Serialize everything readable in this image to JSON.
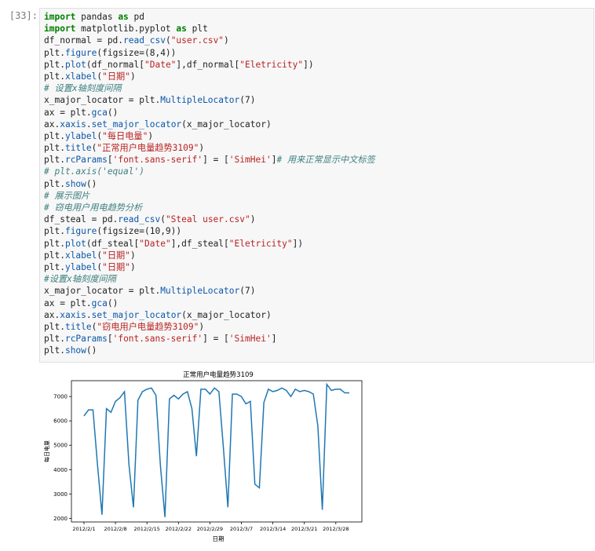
{
  "cell": {
    "prompt": "[33]:"
  },
  "code_lines": [
    [
      {
        "t": "kw",
        "v": "import"
      },
      {
        "t": "n",
        "v": " pandas "
      },
      {
        "t": "kw",
        "v": "as"
      },
      {
        "t": "n",
        "v": " pd"
      }
    ],
    [
      {
        "t": "kw",
        "v": "import"
      },
      {
        "t": "n",
        "v": " matplotlib.pyplot "
      },
      {
        "t": "kw",
        "v": "as"
      },
      {
        "t": "n",
        "v": " plt"
      }
    ],
    [
      {
        "t": "n",
        "v": "df_normal = pd."
      },
      {
        "t": "fn",
        "v": "read_csv"
      },
      {
        "t": "n",
        "v": "("
      },
      {
        "t": "st",
        "v": "\"user.csv\""
      },
      {
        "t": "n",
        "v": ")"
      }
    ],
    [
      {
        "t": "n",
        "v": "plt."
      },
      {
        "t": "fn",
        "v": "figure"
      },
      {
        "t": "n",
        "v": "(figsize=(8,4))"
      }
    ],
    [
      {
        "t": "n",
        "v": "plt."
      },
      {
        "t": "fn",
        "v": "plot"
      },
      {
        "t": "n",
        "v": "(df_normal["
      },
      {
        "t": "st",
        "v": "\"Date\""
      },
      {
        "t": "n",
        "v": "],df_normal["
      },
      {
        "t": "st",
        "v": "\"Eletricity\""
      },
      {
        "t": "n",
        "v": "])"
      }
    ],
    [
      {
        "t": "n",
        "v": "plt."
      },
      {
        "t": "fn",
        "v": "xlabel"
      },
      {
        "t": "n",
        "v": "("
      },
      {
        "t": "st",
        "v": "\"日期\""
      },
      {
        "t": "n",
        "v": ")"
      }
    ],
    [
      {
        "t": "cm",
        "v": "# 设置x轴刻度间隔"
      }
    ],
    [
      {
        "t": "n",
        "v": "x_major_locator = plt."
      },
      {
        "t": "fn",
        "v": "MultipleLocator"
      },
      {
        "t": "n",
        "v": "(7)"
      }
    ],
    [
      {
        "t": "n",
        "v": "ax = plt."
      },
      {
        "t": "fn",
        "v": "gca"
      },
      {
        "t": "n",
        "v": "()"
      }
    ],
    [
      {
        "t": "n",
        "v": "ax."
      },
      {
        "t": "fn",
        "v": "xaxis"
      },
      {
        "t": "n",
        "v": "."
      },
      {
        "t": "fn",
        "v": "set_major_locator"
      },
      {
        "t": "n",
        "v": "(x_major_locator)"
      }
    ],
    [
      {
        "t": "n",
        "v": "plt."
      },
      {
        "t": "fn",
        "v": "ylabel"
      },
      {
        "t": "n",
        "v": "("
      },
      {
        "t": "st",
        "v": "\"每日电量\""
      },
      {
        "t": "n",
        "v": ")"
      }
    ],
    [
      {
        "t": "n",
        "v": "plt."
      },
      {
        "t": "fn",
        "v": "title"
      },
      {
        "t": "n",
        "v": "("
      },
      {
        "t": "st",
        "v": "\"正常用户电量趋势3109\""
      },
      {
        "t": "n",
        "v": ")"
      }
    ],
    [
      {
        "t": "n",
        "v": "plt."
      },
      {
        "t": "fn",
        "v": "rcParams"
      },
      {
        "t": "n",
        "v": "["
      },
      {
        "t": "st",
        "v": "'font.sans-serif'"
      },
      {
        "t": "n",
        "v": "] = ["
      },
      {
        "t": "st",
        "v": "'SimHei'"
      },
      {
        "t": "n",
        "v": "]"
      },
      {
        "t": "cm",
        "v": "# 用来正常显示中文标签"
      }
    ],
    [
      {
        "t": "cm",
        "v": "# plt.axis('equal')"
      }
    ],
    [
      {
        "t": "n",
        "v": "plt."
      },
      {
        "t": "fn",
        "v": "show"
      },
      {
        "t": "n",
        "v": "()"
      }
    ],
    [
      {
        "t": "cm",
        "v": "# 展示图片"
      }
    ],
    [
      {
        "t": "cm",
        "v": "# 窃电用户用电趋势分析"
      }
    ],
    [
      {
        "t": "n",
        "v": "df_steal = pd."
      },
      {
        "t": "fn",
        "v": "read_csv"
      },
      {
        "t": "n",
        "v": "("
      },
      {
        "t": "st",
        "v": "\"Steal user.csv\""
      },
      {
        "t": "n",
        "v": ")"
      }
    ],
    [
      {
        "t": "n",
        "v": "plt."
      },
      {
        "t": "fn",
        "v": "figure"
      },
      {
        "t": "n",
        "v": "(figsize=(10,9))"
      }
    ],
    [
      {
        "t": "n",
        "v": "plt."
      },
      {
        "t": "fn",
        "v": "plot"
      },
      {
        "t": "n",
        "v": "(df_steal["
      },
      {
        "t": "st",
        "v": "\"Date\""
      },
      {
        "t": "n",
        "v": "],df_steal["
      },
      {
        "t": "st",
        "v": "\"Eletricity\""
      },
      {
        "t": "n",
        "v": "])"
      }
    ],
    [
      {
        "t": "n",
        "v": "plt."
      },
      {
        "t": "fn",
        "v": "xlabel"
      },
      {
        "t": "n",
        "v": "("
      },
      {
        "t": "st",
        "v": "\"日期\""
      },
      {
        "t": "n",
        "v": ")"
      }
    ],
    [
      {
        "t": "n",
        "v": "plt."
      },
      {
        "t": "fn",
        "v": "ylabel"
      },
      {
        "t": "n",
        "v": "("
      },
      {
        "t": "st",
        "v": "\"日期\""
      },
      {
        "t": "n",
        "v": ")"
      }
    ],
    [
      {
        "t": "cm",
        "v": "#设置x轴刻度间隔"
      }
    ],
    [
      {
        "t": "n",
        "v": "x_major_locator = plt."
      },
      {
        "t": "fn",
        "v": "MultipleLocator"
      },
      {
        "t": "n",
        "v": "(7)"
      }
    ],
    [
      {
        "t": "n",
        "v": "ax = plt."
      },
      {
        "t": "fn",
        "v": "gca"
      },
      {
        "t": "n",
        "v": "()"
      }
    ],
    [
      {
        "t": "n",
        "v": "ax."
      },
      {
        "t": "fn",
        "v": "xaxis"
      },
      {
        "t": "n",
        "v": "."
      },
      {
        "t": "fn",
        "v": "set_major_locator"
      },
      {
        "t": "n",
        "v": "(x_major_locator)"
      }
    ],
    [
      {
        "t": "n",
        "v": "plt."
      },
      {
        "t": "fn",
        "v": "title"
      },
      {
        "t": "n",
        "v": "("
      },
      {
        "t": "st",
        "v": "\"窃电用户电量趋势3109\""
      },
      {
        "t": "n",
        "v": ")"
      }
    ],
    [
      {
        "t": "n",
        "v": "plt."
      },
      {
        "t": "fn",
        "v": "rcParams"
      },
      {
        "t": "n",
        "v": "["
      },
      {
        "t": "st",
        "v": "'font.sans-serif'"
      },
      {
        "t": "n",
        "v": "] = ["
      },
      {
        "t": "st",
        "v": "'SimHei'"
      },
      {
        "t": "n",
        "v": "]"
      }
    ],
    [
      {
        "t": "n",
        "v": "plt."
      },
      {
        "t": "fn",
        "v": "show"
      },
      {
        "t": "n",
        "v": "()"
      }
    ]
  ],
  "colors": {
    "keyword": "#008000",
    "function": "#0b57a8",
    "string": "#ba2121",
    "comment": "#408080",
    "line": "#1f77b4",
    "cell_bg": "#f7f7f7",
    "prompt": "#7a7a7a"
  },
  "chart_data": {
    "type": "line",
    "title": "正常用户电量趋势3109",
    "xlabel": "日期",
    "ylabel": "每日电量",
    "xticks": [
      "2012/2/1",
      "2012/2/8",
      "2012/2/15",
      "2012/2/22",
      "2012/2/29",
      "2012/3/7",
      "2012/3/14",
      "2012/3/21",
      "2012/3/28"
    ],
    "yticks": [
      2000,
      3000,
      4000,
      5000,
      6000,
      7000
    ],
    "ylim": [
      1850,
      7650
    ],
    "x": [
      "2012/2/1",
      "2012/2/2",
      "2012/2/3",
      "2012/2/4",
      "2012/2/5",
      "2012/2/6",
      "2012/2/7",
      "2012/2/8",
      "2012/2/9",
      "2012/2/10",
      "2012/2/11",
      "2012/2/12",
      "2012/2/13",
      "2012/2/14",
      "2012/2/15",
      "2012/2/16",
      "2012/2/17",
      "2012/2/18",
      "2012/2/19",
      "2012/2/20",
      "2012/2/21",
      "2012/2/22",
      "2012/2/23",
      "2012/2/24",
      "2012/2/25",
      "2012/2/26",
      "2012/2/27",
      "2012/2/28",
      "2012/2/29",
      "2012/3/1",
      "2012/3/2",
      "2012/3/3",
      "2012/3/4",
      "2012/3/5",
      "2012/3/6",
      "2012/3/7",
      "2012/3/8",
      "2012/3/9",
      "2012/3/10",
      "2012/3/11",
      "2012/3/12",
      "2012/3/13",
      "2012/3/14",
      "2012/3/15",
      "2012/3/16",
      "2012/3/17",
      "2012/3/18",
      "2012/3/19",
      "2012/3/20",
      "2012/3/21",
      "2012/3/22",
      "2012/3/23",
      "2012/3/24",
      "2012/3/25",
      "2012/3/26",
      "2012/3/27",
      "2012/3/28",
      "2012/3/29",
      "2012/3/30",
      "2012/3/31"
    ],
    "values": [
      6200,
      6450,
      6450,
      4200,
      2150,
      6500,
      6350,
      6800,
      6950,
      7200,
      4200,
      2450,
      6850,
      7200,
      7300,
      7350,
      7050,
      4150,
      2050,
      6900,
      7050,
      6900,
      7100,
      7200,
      6500,
      4550,
      7300,
      7300,
      7100,
      7350,
      7200,
      4900,
      2450,
      7100,
      7100,
      7000,
      6700,
      6800,
      3400,
      3250,
      6750,
      7300,
      7200,
      7250,
      7350,
      7250,
      7000,
      7300,
      7200,
      7250,
      7200,
      7100,
      5800,
      2350,
      7500,
      7250,
      7300,
      7300,
      7150,
      7150
    ]
  }
}
